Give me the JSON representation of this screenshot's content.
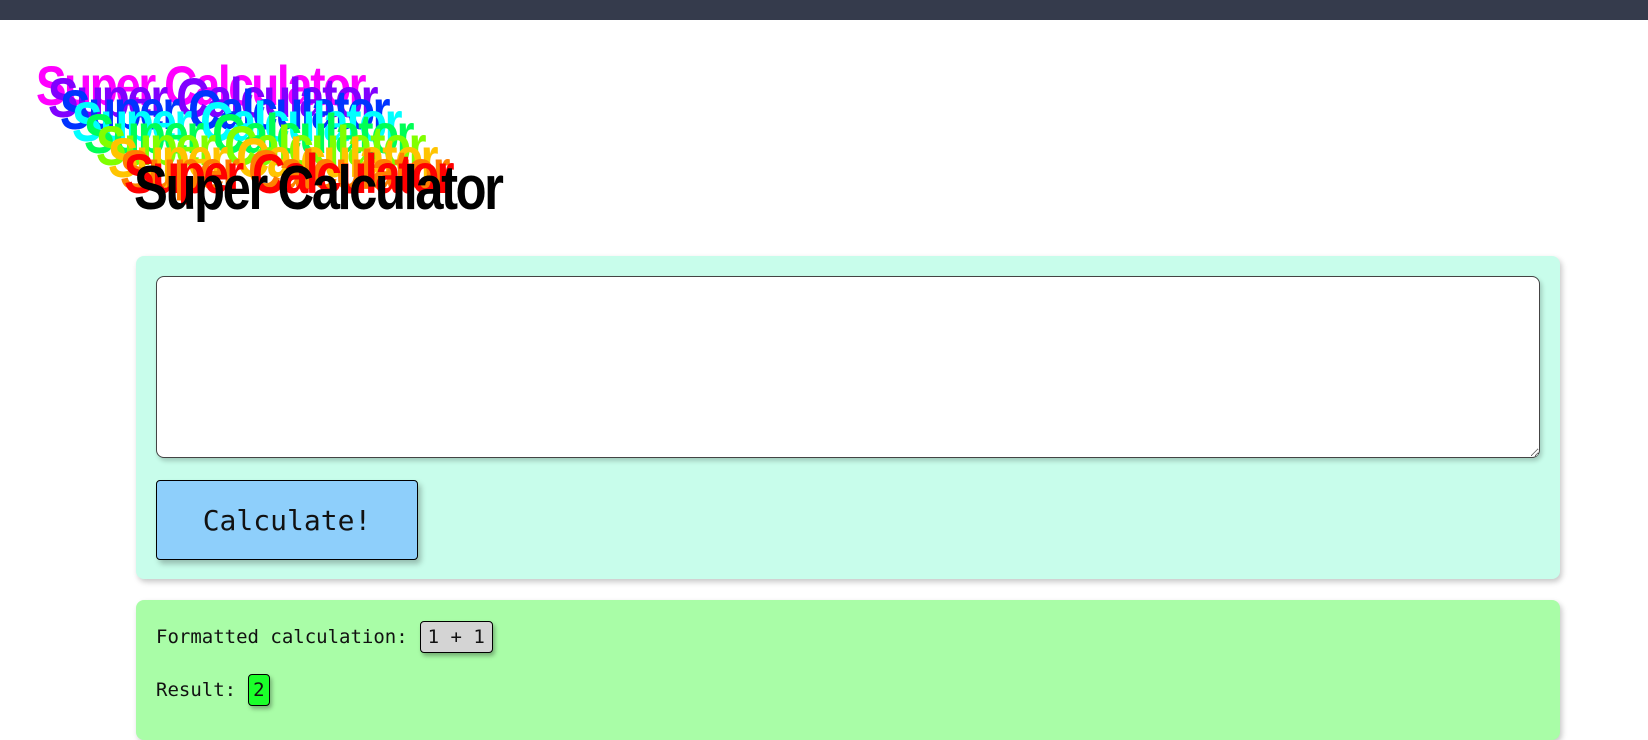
{
  "app": {
    "title": "Super Calculator",
    "title_colors": [
      "#ff00ff",
      "#8000ff",
      "#0033ff",
      "#00ffff",
      "#00ff55",
      "#80ff00",
      "#ffc400",
      "#ff8000",
      "#ff0000",
      "#000000"
    ]
  },
  "calculator": {
    "input_value": "",
    "button_label": "Calculate!"
  },
  "results": {
    "formatted_label": "Formatted calculation:",
    "formatted_value": "1 + 1",
    "result_label": "Result:",
    "result_value": "2"
  },
  "colors": {
    "topbar": "#353b4c",
    "input_panel": "#c8fdeb",
    "result_panel": "#a9fda7",
    "button": "#8ecffb",
    "result_chip": "#1bff2a",
    "formatted_chip": "#d4d4d4"
  }
}
